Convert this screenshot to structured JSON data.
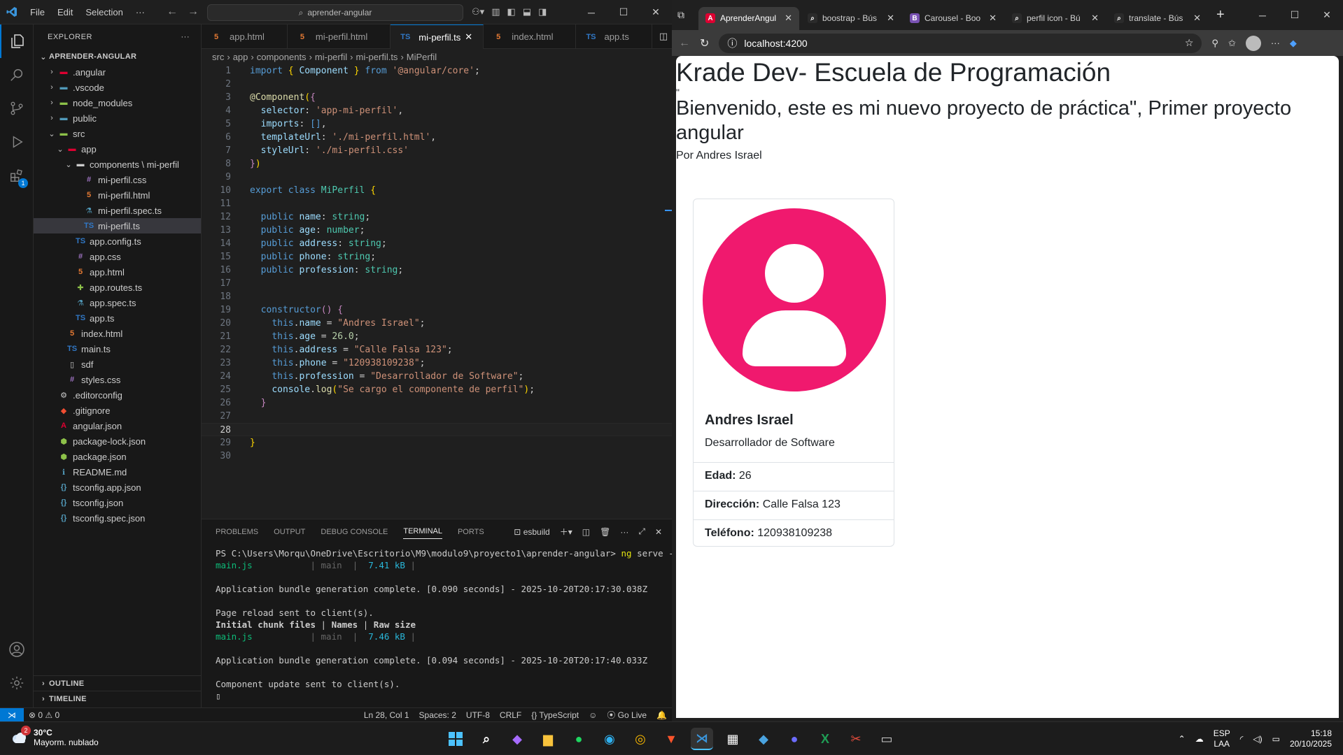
{
  "vscode": {
    "menu": [
      "File",
      "Edit",
      "Selection",
      "···"
    ],
    "search": "aprender-angular",
    "explorer_title": "EXPLORER",
    "project": "APRENDER-ANGULAR",
    "activity_badge": "1",
    "tree": [
      {
        "indent": 1,
        "chev": "›",
        "icon": "folder",
        "iconColor": "fi-ng",
        "label": ".angular"
      },
      {
        "indent": 1,
        "chev": "›",
        "icon": "folder",
        "iconColor": "fi-spec",
        "label": ".vscode"
      },
      {
        "indent": 1,
        "chev": "›",
        "icon": "folder",
        "iconColor": "fi-green",
        "label": "node_modules"
      },
      {
        "indent": 1,
        "chev": "›",
        "icon": "folder",
        "iconColor": "fi-spec",
        "label": "public"
      },
      {
        "indent": 1,
        "chev": "⌄",
        "icon": "folder",
        "iconColor": "fi-green",
        "label": "src"
      },
      {
        "indent": 2,
        "chev": "⌄",
        "icon": "folder",
        "iconColor": "fi-ng",
        "label": "app"
      },
      {
        "indent": 3,
        "chev": "⌄",
        "icon": "folder",
        "iconColor": "fi-txt",
        "label": "components \\ mi-perfil"
      },
      {
        "indent": 4,
        "chev": "",
        "icon": "#",
        "iconColor": "fi-css",
        "label": "mi-perfil.css"
      },
      {
        "indent": 4,
        "chev": "",
        "icon": "5",
        "iconColor": "fi-html",
        "label": "mi-perfil.html"
      },
      {
        "indent": 4,
        "chev": "",
        "icon": "⚗",
        "iconColor": "fi-spec",
        "label": "mi-perfil.spec.ts"
      },
      {
        "indent": 4,
        "chev": "",
        "icon": "TS",
        "iconColor": "fi-ts",
        "label": "mi-perfil.ts",
        "selected": true
      },
      {
        "indent": 3,
        "chev": "",
        "icon": "TS",
        "iconColor": "fi-ts",
        "label": "app.config.ts"
      },
      {
        "indent": 3,
        "chev": "",
        "icon": "#",
        "iconColor": "fi-css",
        "label": "app.css"
      },
      {
        "indent": 3,
        "chev": "",
        "icon": "5",
        "iconColor": "fi-html",
        "label": "app.html"
      },
      {
        "indent": 3,
        "chev": "",
        "icon": "✚",
        "iconColor": "fi-green",
        "label": "app.routes.ts"
      },
      {
        "indent": 3,
        "chev": "",
        "icon": "⚗",
        "iconColor": "fi-spec",
        "label": "app.spec.ts"
      },
      {
        "indent": 3,
        "chev": "",
        "icon": "TS",
        "iconColor": "fi-ts",
        "label": "app.ts"
      },
      {
        "indent": 2,
        "chev": "",
        "icon": "5",
        "iconColor": "fi-html",
        "label": "index.html"
      },
      {
        "indent": 2,
        "chev": "",
        "icon": "TS",
        "iconColor": "fi-ts",
        "label": "main.ts"
      },
      {
        "indent": 2,
        "chev": "",
        "icon": "▯",
        "iconColor": "fi-txt",
        "label": "sdf"
      },
      {
        "indent": 2,
        "chev": "",
        "icon": "#",
        "iconColor": "fi-css",
        "label": "styles.css"
      },
      {
        "indent": 1,
        "chev": "",
        "icon": "⚙",
        "iconColor": "fi-gear",
        "label": ".editorconfig"
      },
      {
        "indent": 1,
        "chev": "",
        "icon": "◆",
        "iconColor": "fi-git",
        "label": ".gitignore"
      },
      {
        "indent": 1,
        "chev": "",
        "icon": "A",
        "iconColor": "fi-ng",
        "label": "angular.json"
      },
      {
        "indent": 1,
        "chev": "",
        "icon": "⬢",
        "iconColor": "fi-green",
        "label": "package-lock.json"
      },
      {
        "indent": 1,
        "chev": "",
        "icon": "⬢",
        "iconColor": "fi-green",
        "label": "package.json"
      },
      {
        "indent": 1,
        "chev": "",
        "icon": "ℹ",
        "iconColor": "fi-info",
        "label": "README.md"
      },
      {
        "indent": 1,
        "chev": "",
        "icon": "{}",
        "iconColor": "fi-spec",
        "label": "tsconfig.app.json"
      },
      {
        "indent": 1,
        "chev": "",
        "icon": "{}",
        "iconColor": "fi-spec",
        "label": "tsconfig.json"
      },
      {
        "indent": 1,
        "chev": "",
        "icon": "{}",
        "iconColor": "fi-spec",
        "label": "tsconfig.spec.json"
      }
    ],
    "outline": "OUTLINE",
    "timeline": "TIMELINE",
    "tabs": [
      {
        "label": "app.html",
        "icon": "5",
        "iconColor": "fi-html"
      },
      {
        "label": "mi-perfil.html",
        "icon": "5",
        "iconColor": "fi-html"
      },
      {
        "label": "mi-perfil.ts",
        "icon": "TS",
        "iconColor": "fi-ts",
        "active": true
      },
      {
        "label": "index.html",
        "icon": "5",
        "iconColor": "fi-html"
      },
      {
        "label": "app.ts",
        "icon": "TS",
        "iconColor": "fi-ts"
      }
    ],
    "breadcrumb": [
      "src",
      "app",
      "components",
      "mi-perfil",
      "mi-perfil.ts",
      "MiPerfil"
    ],
    "code": [
      "<span class='k'>import</span> <span class='b'>{</span> <span class='p'>Component</span> <span class='b'>}</span> <span class='k'>from</span> <span class='s'>'@angular/core'</span>;",
      "",
      "<span class='d'>@Component</span><span class='b'>(</span><span class='kw'>{</span>",
      "  <span class='p'>selector</span>: <span class='s'>'app-mi-perfil'</span>,",
      "  <span class='p'>imports</span>: <span class='k'>[]</span>,",
      "  <span class='p'>templateUrl</span>: <span class='s'>'./mi-perfil.html'</span>,",
      "  <span class='p'>styleUrl</span>: <span class='s'>'./mi-perfil.css'</span>",
      "<span class='kw'>}</span><span class='b'>)</span>",
      "",
      "<span class='k'>export</span> <span class='k'>class</span> <span class='t'>MiPerfil</span> <span class='b'>{</span>",
      "",
      "  <span class='k'>public</span> <span class='p'>name</span>: <span class='t'>string</span>;",
      "  <span class='k'>public</span> <span class='p'>age</span>: <span class='t'>number</span>;",
      "  <span class='k'>public</span> <span class='p'>address</span>: <span class='t'>string</span>;",
      "  <span class='k'>public</span> <span class='p'>phone</span>: <span class='t'>string</span>;",
      "  <span class='k'>public</span> <span class='p'>profession</span>: <span class='t'>string</span>;",
      "",
      "",
      "  <span class='k'>constructor</span><span class='kw'>()</span> <span class='kw'>{</span>",
      "    <span class='k'>this</span>.<span class='p'>name</span> = <span class='s'>\"Andres Israel\"</span>;",
      "    <span class='k'>this</span>.<span class='p'>age</span> = <span class='n'>26.0</span>;",
      "    <span class='k'>this</span>.<span class='p'>address</span> = <span class='s'>\"Calle Falsa 123\"</span>;",
      "    <span class='k'>this</span>.<span class='p'>phone</span> = <span class='s'>\"120938109238\"</span>;",
      "    <span class='k'>this</span>.<span class='p'>profession</span> = <span class='s'>\"Desarrollador de Software\"</span>;",
      "    <span class='p'>console</span>.<span class='f'>log</span><span class='b'>(</span><span class='s'>\"Se cargo el componente de perfil\"</span><span class='b'>)</span>;",
      "  <span class='kw'>}</span>",
      "",
      "",
      "<span class='b'>}</span>",
      ""
    ],
    "current_line": 28,
    "panel_tabs": [
      "PROBLEMS",
      "OUTPUT",
      "DEBUG CONSOLE",
      "TERMINAL",
      "PORTS"
    ],
    "active_panel_tab": "TERMINAL",
    "terminal_name": "esbuild",
    "terminal": "PS C:\\Users\\Morqu\\OneDrive\\Escritorio\\M9\\modulo9\\proyecto1\\aprender-angular> <span class='ty'>ng</span> serve -o\n<span class='tg'>main.js</span>           <span class='tgr'>| main  | </span> <span class='tb'>7.41 kB</span> <span class='tgr'>|</span>\n\nApplication bundle generation complete. [0.090 seconds] - 2025-10-20T20:17:30.038Z\n\nPage reload sent to client(s).\n<b>Initial chunk files</b> | <b>Names</b> | <b>Raw size</b>\n<span class='tg'>main.js</span>           <span class='tgr'>| main  | </span> <span class='tb'>7.46 kB</span> <span class='tgr'>|</span>\n\nApplication bundle generation complete. [0.094 seconds] - 2025-10-20T20:17:40.033Z\n\nComponent update sent to client(s).\n▯",
    "status": {
      "errors": "⊗ 0 ⚠ 0",
      "position": "Ln 28, Col 1",
      "spaces": "Spaces: 2",
      "encoding": "UTF-8",
      "eol": "CRLF",
      "language": "{} TypeScript",
      "golive": "⦿ Go Live"
    }
  },
  "browser": {
    "tabs": [
      {
        "label": "AprenderAngul",
        "fav": "A",
        "favColor": "#dd0031",
        "active": true
      },
      {
        "label": "boostrap - Bús",
        "fav": "⌕",
        "favColor": "#2b2b2b"
      },
      {
        "label": "Carousel - Boo",
        "fav": "B",
        "favColor": "#7952b3"
      },
      {
        "label": "perfil icon - Bú",
        "fav": "⌕",
        "favColor": "#2b2b2b"
      },
      {
        "label": "translate - Bús",
        "fav": "⌕",
        "favColor": "#2b2b2b"
      }
    ],
    "url": "localhost:4200",
    "page": {
      "title": "Krade Dev- Escuela de Programación",
      "stray": "\"",
      "subtitle": "Bienvenido, este es mi nuevo proyecto de práctica\", Primer proyecto angular",
      "byline": "Por Andres Israel",
      "card": {
        "name": "Andres Israel",
        "profession": "Desarrollador de Software",
        "items": [
          {
            "label": "Edad:",
            "value": "26"
          },
          {
            "label": "Dirección:",
            "value": "Calle Falsa 123"
          },
          {
            "label": "Teléfono:",
            "value": "120938109238"
          }
        ],
        "avatar_color": "#f0196e"
      }
    }
  },
  "taskbar": {
    "temp": "30°C",
    "weather": "Mayorm. nublado",
    "weather_badge": "2",
    "lang": "ESP",
    "lang2": "LAA",
    "time": "15:18",
    "date": "20/10/2025"
  }
}
